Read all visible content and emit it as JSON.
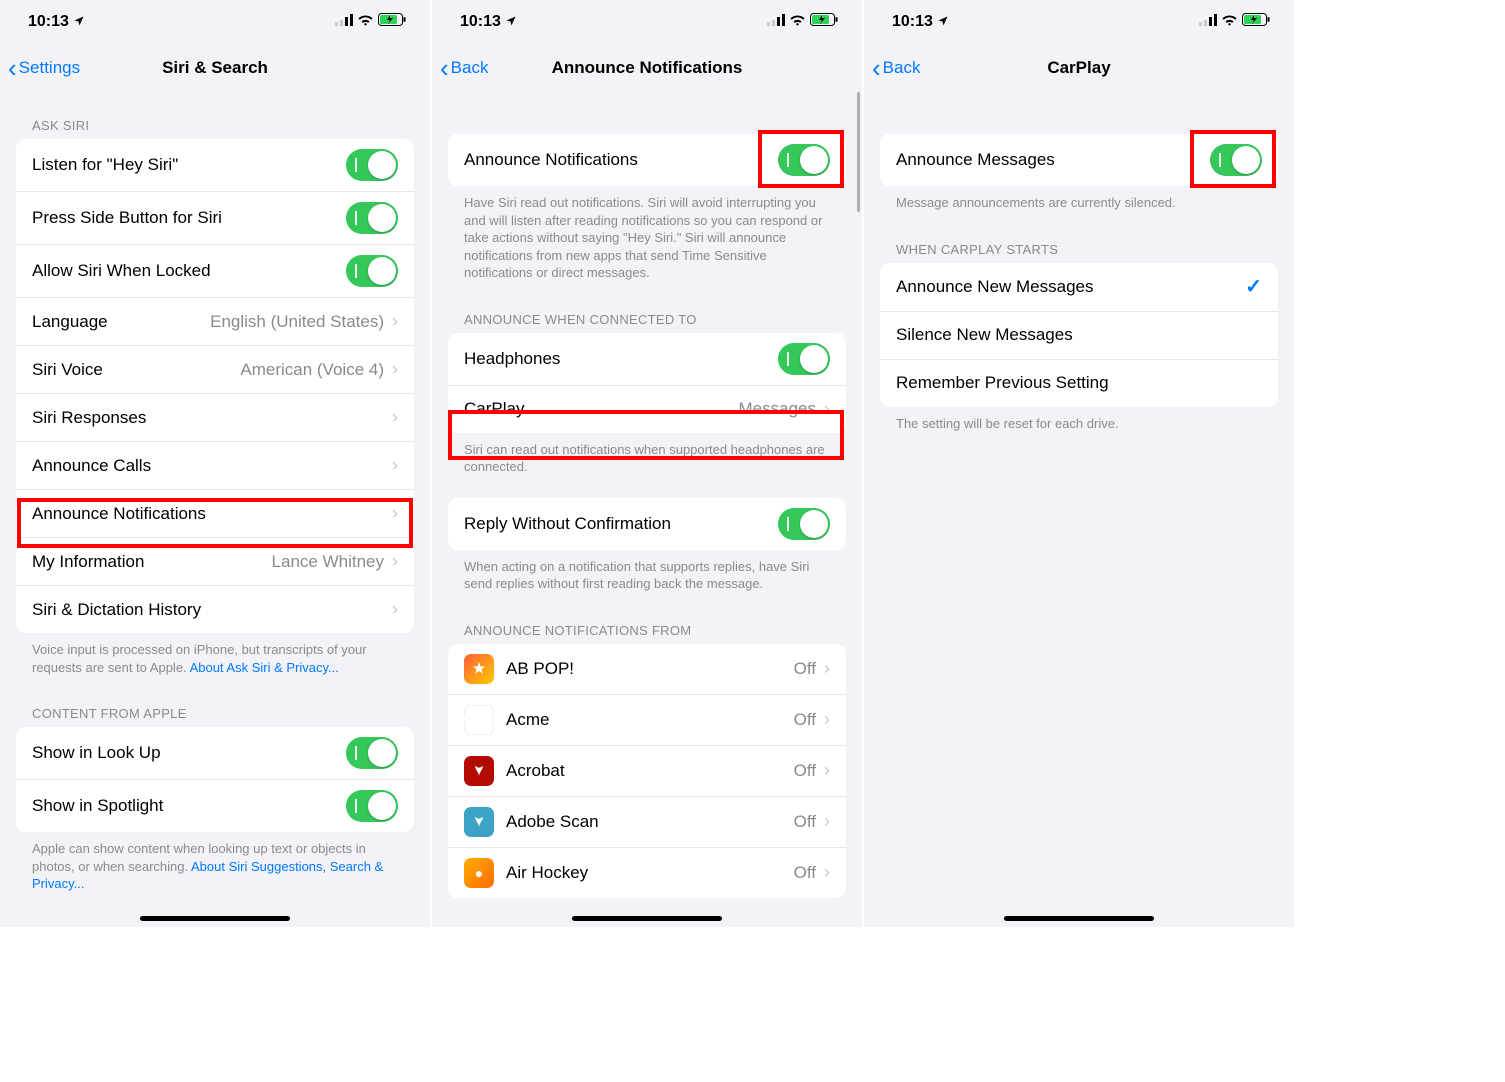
{
  "status": {
    "time": "10:13"
  },
  "panel1": {
    "back": "Settings",
    "title": "Siri & Search",
    "header_ask_siri": "ASK SIRI",
    "rows": {
      "listen": "Listen for \"Hey Siri\"",
      "press_side": "Press Side Button for Siri",
      "allow_locked": "Allow Siri When Locked",
      "language": "Language",
      "language_val": "English (United States)",
      "voice": "Siri Voice",
      "voice_val": "American (Voice 4)",
      "responses": "Siri Responses",
      "announce_calls": "Announce Calls",
      "announce_notif": "Announce Notifications",
      "my_info": "My Information",
      "my_info_val": "Lance Whitney",
      "history": "Siri & Dictation History"
    },
    "footer_voice": "Voice input is processed on iPhone, but transcripts of your requests are sent to Apple. ",
    "footer_voice_link": "About Ask Siri & Privacy...",
    "header_content": "CONTENT FROM APPLE",
    "lookup": "Show in Look Up",
    "spotlight": "Show in Spotlight",
    "footer_content": "Apple can show content when looking up text or objects in photos, or when searching. ",
    "footer_content_link": "About Siri Suggestions, Search & Privacy..."
  },
  "panel2": {
    "back": "Back",
    "title": "Announce Notifications",
    "announce_notif": "Announce Notifications",
    "footer_announce": "Have Siri read out notifications. Siri will avoid interrupting you and will listen after reading notifications so you can respond or take actions without saying \"Hey Siri.\" Siri will announce notifications from new apps that send Time Sensitive notifications or direct messages.",
    "header_connected": "ANNOUNCE WHEN CONNECTED TO",
    "headphones": "Headphones",
    "carplay": "CarPlay",
    "carplay_val": "Messages",
    "footer_connected": "Siri can read out notifications when supported headphones are connected.",
    "reply": "Reply Without Confirmation",
    "footer_reply": "When acting on a notification that supports replies, have Siri send replies without first reading back the message.",
    "header_from": "ANNOUNCE NOTIFICATIONS FROM",
    "apps": [
      {
        "name": "AB POP!",
        "state": "Off"
      },
      {
        "name": "Acme",
        "state": "Off"
      },
      {
        "name": "Acrobat",
        "state": "Off"
      },
      {
        "name": "Adobe Scan",
        "state": "Off"
      },
      {
        "name": "Air Hockey",
        "state": "Off"
      }
    ]
  },
  "panel3": {
    "back": "Back",
    "title": "CarPlay",
    "announce_msgs": "Announce Messages",
    "footer_msgs": "Message announcements are currently silenced.",
    "header_when": "WHEN CARPLAY STARTS",
    "opt_new": "Announce New Messages",
    "opt_silence": "Silence New Messages",
    "opt_remember": "Remember Previous Setting",
    "footer_when": "The setting will be reset for each drive."
  }
}
